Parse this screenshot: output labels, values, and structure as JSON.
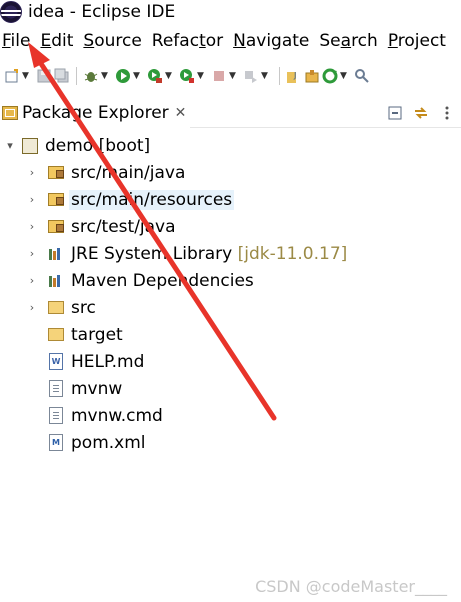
{
  "window": {
    "title": "idea - Eclipse IDE",
    "icon": "eclipse-icon"
  },
  "menu": [
    {
      "mnemonic": "F",
      "rest": "ile"
    },
    {
      "mnemonic": "E",
      "rest": "dit"
    },
    {
      "mnemonic": "S",
      "rest": "ource"
    },
    {
      "pre": "Refac",
      "mnemonic": "t",
      "rest": "or"
    },
    {
      "mnemonic": "N",
      "rest": "avigate"
    },
    {
      "pre": "Se",
      "mnemonic": "a",
      "rest": "rch"
    },
    {
      "mnemonic": "P",
      "rest": "roject"
    }
  ],
  "view": {
    "tab_label": "Package Explorer",
    "close_glyph": "✕"
  },
  "tree": {
    "root": {
      "label": "demo [boot]"
    },
    "children": [
      {
        "label": "src/main/java",
        "icon": "source-folder-icon",
        "expandable": true
      },
      {
        "label": "src/main/resources",
        "icon": "source-folder-icon",
        "expandable": true,
        "selected": true
      },
      {
        "label": "src/test/java",
        "icon": "source-folder-icon",
        "expandable": true
      },
      {
        "label": "JRE System Library",
        "decoration": "[jdk-11.0.17]",
        "icon": "library-icon",
        "expandable": true
      },
      {
        "label": "Maven Dependencies",
        "icon": "library-icon",
        "expandable": true
      },
      {
        "label": "src",
        "icon": "folder-icon",
        "expandable": true
      },
      {
        "label": "target",
        "icon": "folder-icon",
        "expandable": false
      },
      {
        "label": "HELP.md",
        "icon": "markdown-file-icon",
        "expandable": false
      },
      {
        "label": "mvnw",
        "icon": "file-icon",
        "expandable": false
      },
      {
        "label": "mvnw.cmd",
        "icon": "file-icon",
        "expandable": false
      },
      {
        "label": "pom.xml",
        "icon": "pom-file-icon",
        "expandable": false
      }
    ]
  },
  "annotation": {
    "color": "#e8342a"
  },
  "watermark": "CSDN @codeMaster____"
}
